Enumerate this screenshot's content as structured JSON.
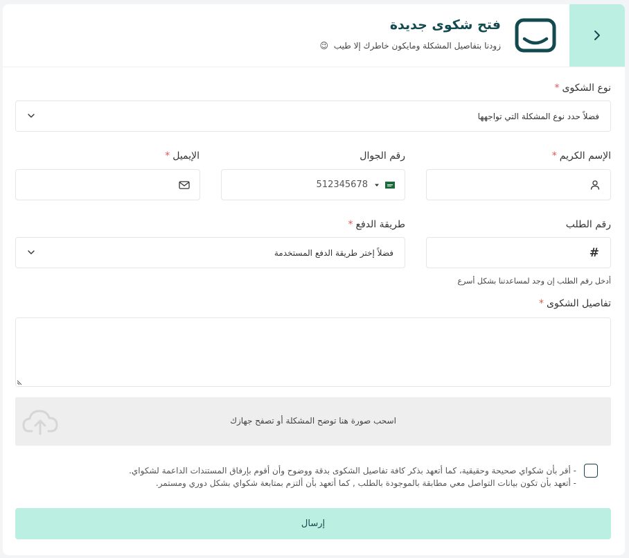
{
  "header": {
    "title": "فتح شكوى جديدة",
    "subtitle": "زودنا بتفاصيل المشكلة ومايكون خاطرك إلا طيب",
    "subtitle_emoji": "😉"
  },
  "form": {
    "complaint_type": {
      "label": "نوع الشكوى",
      "required_mark": "*",
      "placeholder": "فضلاً حدد نوع المشكلة التي تواجهها"
    },
    "name": {
      "label": "الإسم الكريم",
      "required_mark": "*",
      "value": ""
    },
    "mobile": {
      "label": "رقم الجوال",
      "value": "512345678",
      "country_icon": "saudi-flag-icon"
    },
    "email": {
      "label": "الإيميل",
      "required_mark": "*",
      "value": ""
    },
    "order_number": {
      "label": "رقم الطلب",
      "symbol": "#",
      "hint": "أدخل رقم الطلب إن وجد لمساعدتنا بشكل أسرع"
    },
    "payment_method": {
      "label": "طريقة الدفع",
      "required_mark": "*",
      "placeholder": "فضلاً إختر طريقة الدفع المستخدمة"
    },
    "details": {
      "label": "تفاصيل الشكوى",
      "required_mark": "*",
      "value": ""
    },
    "upload": {
      "text": "اسحب صورة هنا توضح المشكلة أو تصفح جهازك"
    },
    "terms": {
      "line1": "- أقر بأن شكواي صحيحة وحقيقية، كما أتعهد بذكر كافة تفاصيل الشكوى بدقة ووضوح وأن أقوم بإرفاق المستندات الداعمة لشكواي.",
      "line2": "- أتعهد بأن تكون بيانات التواصل معي مطابقة بالموجودة بالطلب , كما أتعهد بأن ألتزم بمتابعة شكواي بشكل دوري ومستمر."
    },
    "submit_label": "إرسال"
  },
  "colors": {
    "accent": "#baefe1",
    "title": "#124a4f",
    "required": "#e05555"
  }
}
